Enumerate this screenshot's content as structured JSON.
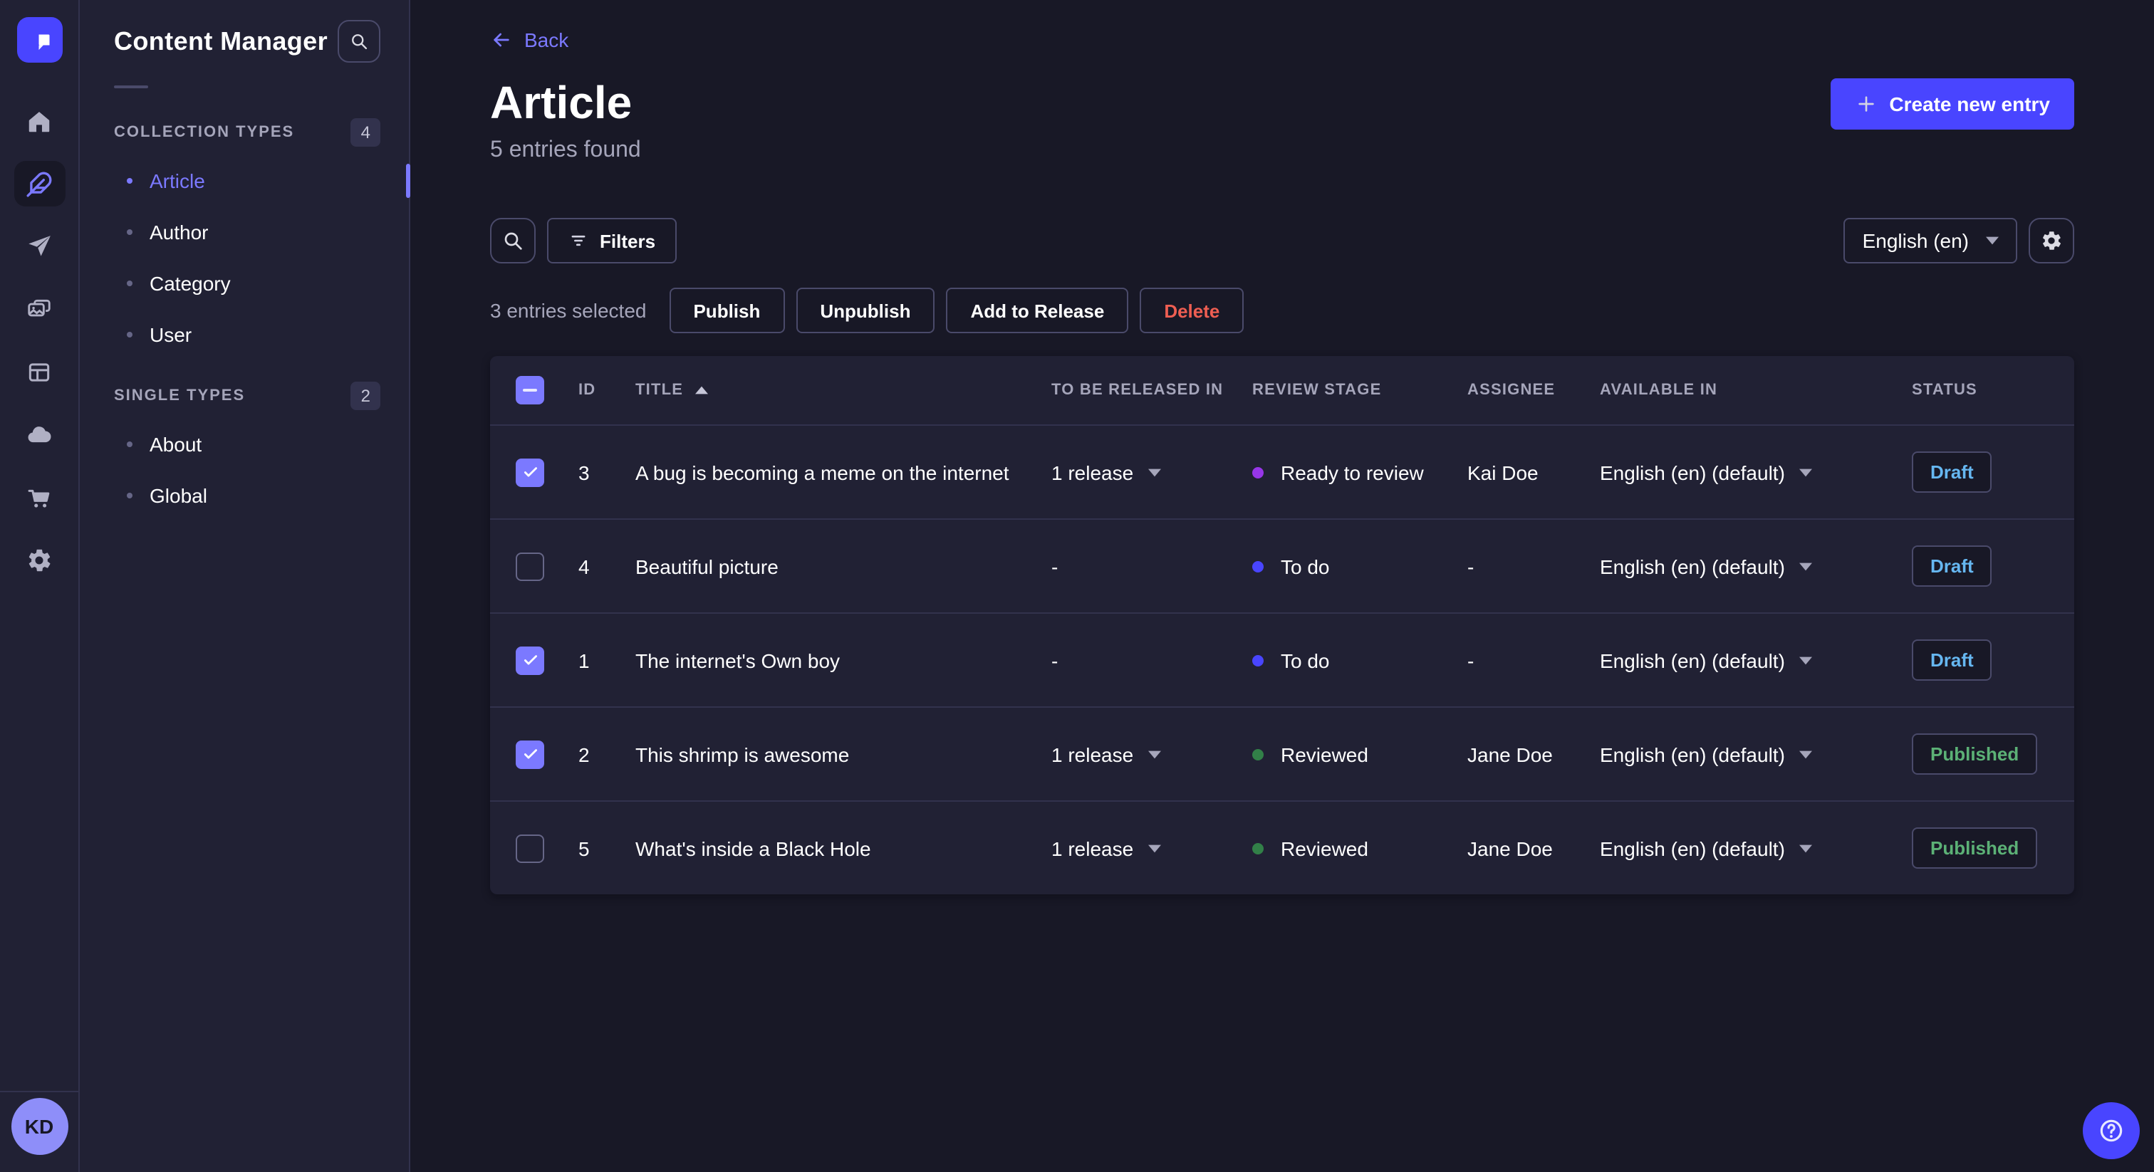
{
  "sidebar": {
    "title": "Content Manager",
    "sections": [
      {
        "label": "COLLECTION TYPES",
        "count": "4",
        "items": [
          {
            "label": "Article",
            "active": true
          },
          {
            "label": "Author"
          },
          {
            "label": "Category"
          },
          {
            "label": "User"
          }
        ]
      },
      {
        "label": "SINGLE TYPES",
        "count": "2",
        "items": [
          {
            "label": "About"
          },
          {
            "label": "Global"
          }
        ]
      }
    ]
  },
  "rail": {
    "avatar_initials": "KD"
  },
  "header": {
    "back_label": "Back",
    "title": "Article",
    "subtitle": "5 entries found",
    "create_button": "Create new entry"
  },
  "toolbar": {
    "filters_label": "Filters",
    "locale_select": "English (en)"
  },
  "selection": {
    "label": "3 entries selected",
    "publish": "Publish",
    "unpublish": "Unpublish",
    "add_to_release": "Add to Release",
    "delete": "Delete"
  },
  "table": {
    "headers": [
      "ID",
      "TITLE",
      "TO BE RELEASED IN",
      "REVIEW STAGE",
      "ASSIGNEE",
      "AVAILABLE IN",
      "STATUS"
    ],
    "sort_column": "TITLE",
    "sort_direction": "asc",
    "rows": [
      {
        "selected": true,
        "id": "3",
        "title": "A bug is becoming a meme on the internet",
        "released_in": "1 release",
        "has_release_menu": true,
        "stage": "Ready to review",
        "stage_color": "#9736e8",
        "assignee": "Kai Doe",
        "available_in": "English (en) (default)",
        "status": "Draft",
        "status_color": "#66b7f1"
      },
      {
        "selected": false,
        "id": "4",
        "title": "Beautiful picture",
        "released_in": "-",
        "has_release_menu": false,
        "stage": "To do",
        "stage_color": "#4945ff",
        "assignee": "-",
        "available_in": "English (en) (default)",
        "status": "Draft",
        "status_color": "#66b7f1"
      },
      {
        "selected": true,
        "id": "1",
        "title": "The internet's Own boy",
        "released_in": "-",
        "has_release_menu": false,
        "stage": "To do",
        "stage_color": "#4945ff",
        "assignee": "-",
        "available_in": "English (en) (default)",
        "status": "Draft",
        "status_color": "#66b7f1"
      },
      {
        "selected": true,
        "id": "2",
        "title": "This shrimp is awesome",
        "released_in": "1 release",
        "has_release_menu": true,
        "stage": "Reviewed",
        "stage_color": "#328048",
        "assignee": "Jane Doe",
        "available_in": "English (en) (default)",
        "status": "Published",
        "status_color": "#5cb176"
      },
      {
        "selected": false,
        "id": "5",
        "title": "What's inside a Black Hole",
        "released_in": "1 release",
        "has_release_menu": true,
        "stage": "Reviewed",
        "stage_color": "#328048",
        "assignee": "Jane Doe",
        "available_in": "English (en) (default)",
        "status": "Published",
        "status_color": "#5cb176"
      }
    ]
  },
  "colors": {
    "primary": "#4945ff",
    "primary_light": "#7b79ff",
    "danger": "#ee5e52",
    "surface": "#212134",
    "background": "#181826",
    "border": "#4a4a6a"
  }
}
